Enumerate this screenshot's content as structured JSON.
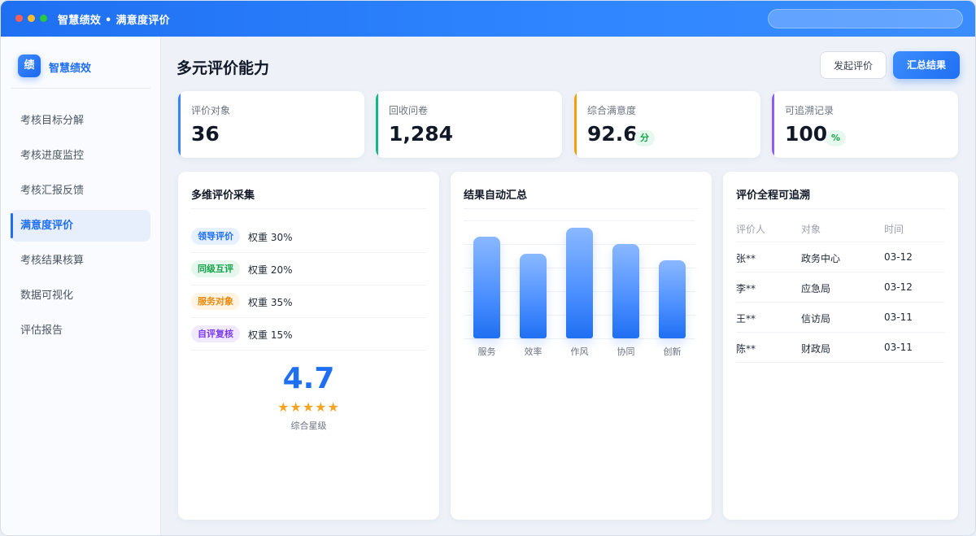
{
  "window": {
    "title": "智慧绩效 • 满意度评价"
  },
  "sidebar": {
    "logo_char": "绩",
    "brand": "智慧绩效",
    "items": [
      {
        "label": "考核目标分解",
        "active": false
      },
      {
        "label": "考核进度监控",
        "active": false
      },
      {
        "label": "考核汇报反馈",
        "active": false
      },
      {
        "label": "满意度评价",
        "active": true
      },
      {
        "label": "考核结果核算",
        "active": false
      },
      {
        "label": "数据可视化",
        "active": false
      },
      {
        "label": "评估报告",
        "active": false
      }
    ]
  },
  "header": {
    "title": "多元评价能力",
    "btn_start": "发起评价",
    "btn_summary": "汇总结果"
  },
  "stats": [
    {
      "label": "评价对象",
      "value": "36",
      "unit": "",
      "accent": "#3b82f6"
    },
    {
      "label": "回收问卷",
      "value": "1,284",
      "unit": "",
      "accent": "#10b981"
    },
    {
      "label": "综合满意度",
      "value": "92.6",
      "unit": "分",
      "accent": "#f59e0b"
    },
    {
      "label": "可追溯记录",
      "value": "100",
      "unit": "%",
      "accent": "#8b5cf6"
    }
  ],
  "collect": {
    "title": "多维评价采集",
    "rows": [
      {
        "tag": "领导评价",
        "weight": "权重 30%",
        "color": "blue"
      },
      {
        "tag": "同级互评",
        "weight": "权重 20%",
        "color": "green"
      },
      {
        "tag": "服务对象",
        "weight": "权重 35%",
        "color": "orange"
      },
      {
        "tag": "自评复核",
        "weight": "权重 15%",
        "color": "purple"
      }
    ],
    "score": "4.7",
    "stars": "★★★★★",
    "score_label": "综合星级"
  },
  "summary": {
    "title": "结果自动汇总"
  },
  "chart_data": {
    "type": "bar",
    "categories": [
      "服务",
      "效率",
      "作风",
      "协同",
      "创新"
    ],
    "values": [
      0.86,
      0.72,
      0.94,
      0.8,
      0.66
    ],
    "ylim": [
      0,
      1
    ],
    "grid": true,
    "bar_color": "#1f6ff2"
  },
  "trace": {
    "title": "评价全程可追溯",
    "headers": [
      "评价人",
      "对象",
      "时间"
    ],
    "rows": [
      [
        "张**",
        "政务中心",
        "03-12"
      ],
      [
        "李**",
        "应急局",
        "03-12"
      ],
      [
        "王**",
        "信访局",
        "03-11"
      ],
      [
        "陈**",
        "财政局",
        "03-11"
      ]
    ]
  }
}
